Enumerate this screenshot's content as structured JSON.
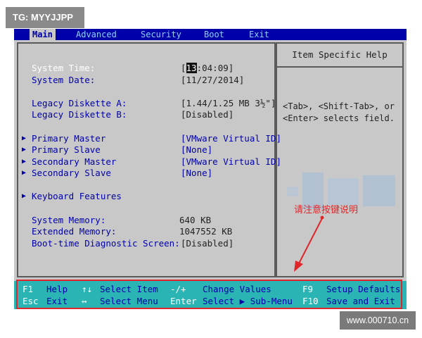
{
  "watermark_top": "TG: MYYJJPP",
  "watermark_bottom": "www.000710.cn",
  "menu": {
    "items": [
      "Main",
      "Advanced",
      "Security",
      "Boot",
      "Exit"
    ],
    "active": "Main"
  },
  "main": {
    "system_time_label": "System Time:",
    "system_time_cursor": "13",
    "system_time_rest": ":04:09]",
    "system_time_open": "[",
    "system_date_label": "System Date:",
    "system_date_value": "[11/27/2014]",
    "legacy_a_label": "Legacy Diskette A:",
    "legacy_a_value": "[1.44/1.25 MB  3½\"]",
    "legacy_b_label": "Legacy Diskette B:",
    "legacy_b_value": "[Disabled]",
    "primary_master_label": "Primary Master",
    "primary_master_value": "[VMware Virtual ID]",
    "primary_slave_label": "Primary Slave",
    "primary_slave_value": "[None]",
    "secondary_master_label": "Secondary Master",
    "secondary_master_value": "[VMware Virtual ID]",
    "secondary_slave_label": "Secondary Slave",
    "secondary_slave_value": "[None]",
    "keyboard_label": "Keyboard Features",
    "system_memory_label": "System Memory:",
    "system_memory_value": "640 KB",
    "extended_memory_label": "Extended Memory:",
    "extended_memory_value": "1047552 KB",
    "boot_diag_label": "Boot-time Diagnostic Screen:",
    "boot_diag_value": "[Disabled]"
  },
  "help": {
    "title": "Item Specific Help",
    "line1": "<Tab>, <Shift-Tab>, or",
    "line2": "<Enter> selects field."
  },
  "annotation": "请注意按键说明",
  "footer": {
    "row1": [
      {
        "key": "F1",
        "desc": "Help"
      },
      {
        "key": "↑↓",
        "desc": "Select Item"
      },
      {
        "key": "-/+",
        "desc": "Change Values"
      },
      {
        "key": "F9",
        "desc": "Setup Defaults"
      }
    ],
    "row2": [
      {
        "key": "Esc",
        "desc": "Exit"
      },
      {
        "key": "↔",
        "desc": "Select Menu"
      },
      {
        "key": "Enter",
        "desc": "Select ▶ Sub-Menu"
      },
      {
        "key": "F10",
        "desc": "Save and Exit"
      }
    ]
  },
  "colors": {
    "bios_blue": "#0000aa",
    "bios_gray": "#c8c8c8",
    "footer_teal": "#2ab4b4",
    "annotation_red": "#e0262b"
  }
}
